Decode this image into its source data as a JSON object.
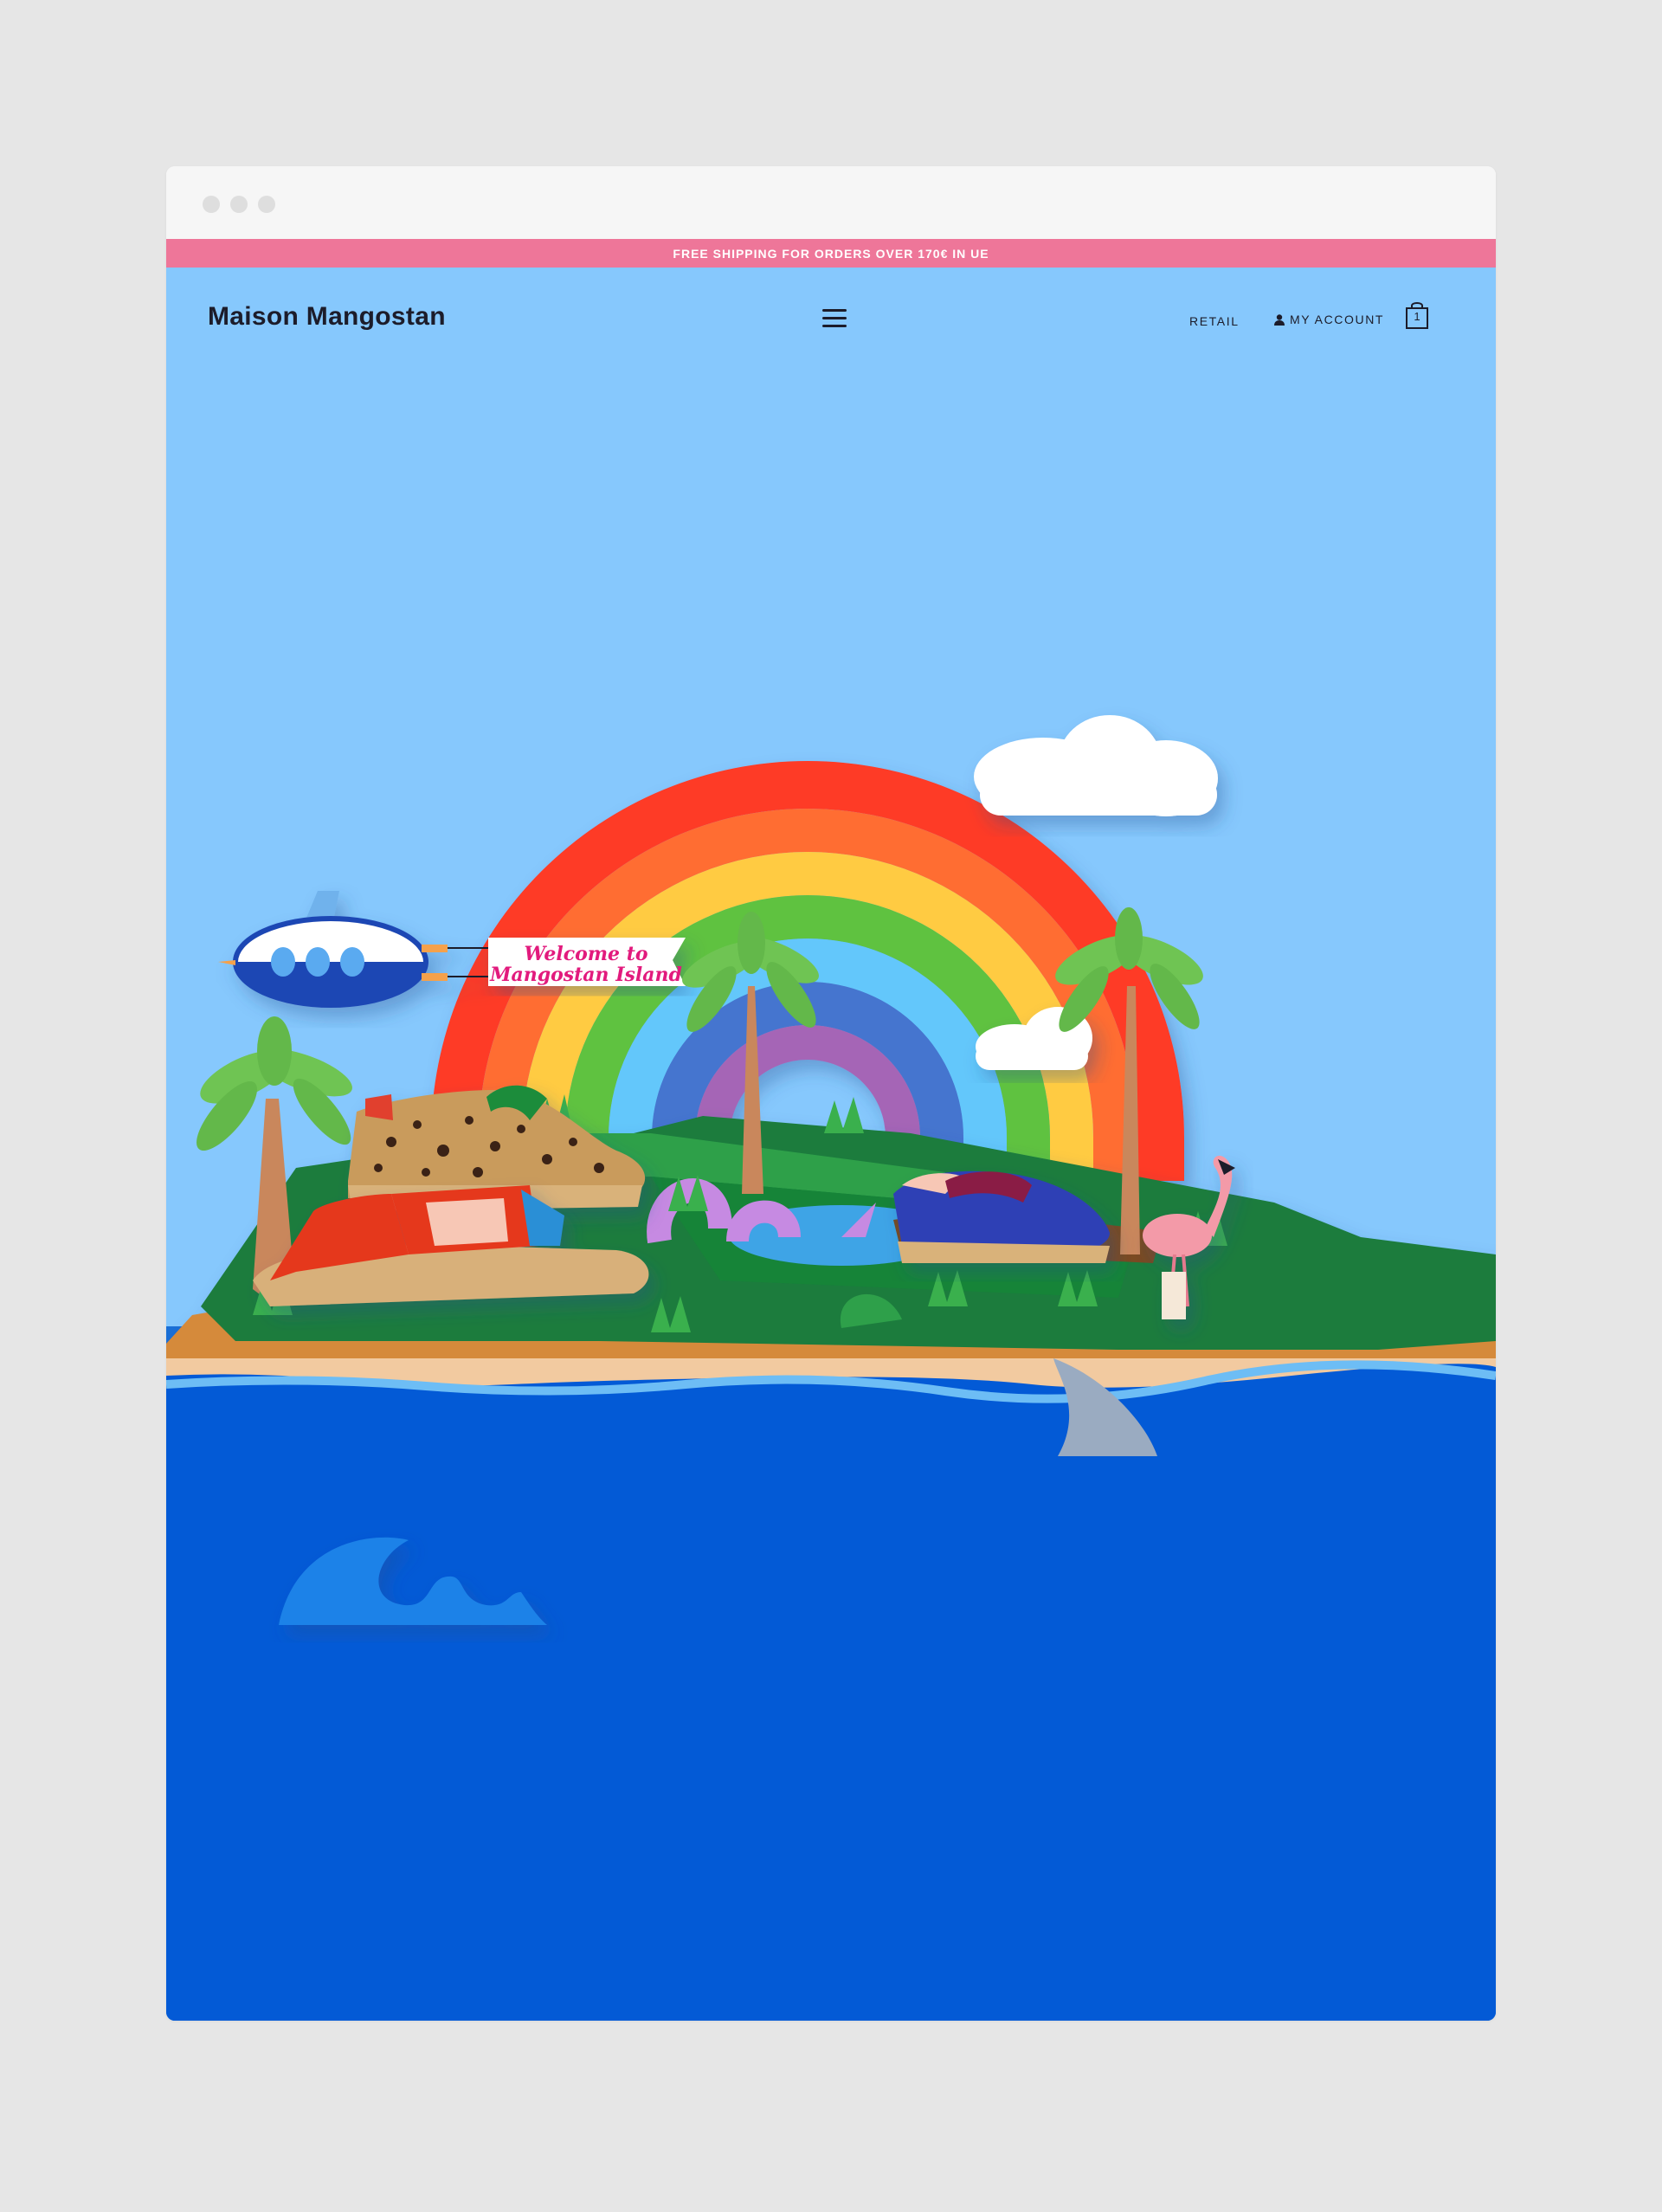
{
  "promo": {
    "text": "FREE SHIPPING FOR ORDERS OVER 170€ IN UE"
  },
  "header": {
    "logo": "Maison Mangostan",
    "nav_retail": "RETAIL",
    "nav_account": "MY ACCOUNT",
    "cart_count": "1"
  },
  "hero": {
    "banner_line1": "Welcome to",
    "banner_line2": "Mangostan Island"
  },
  "icons": {
    "menu": "hamburger-menu-icon",
    "account": "user-icon",
    "cart": "shopping-bag-icon"
  },
  "colors": {
    "promo_bar": "#ee7699",
    "sky": "#86c8fd",
    "sea": "#035ad6",
    "banner_text": "#e21a7d"
  }
}
